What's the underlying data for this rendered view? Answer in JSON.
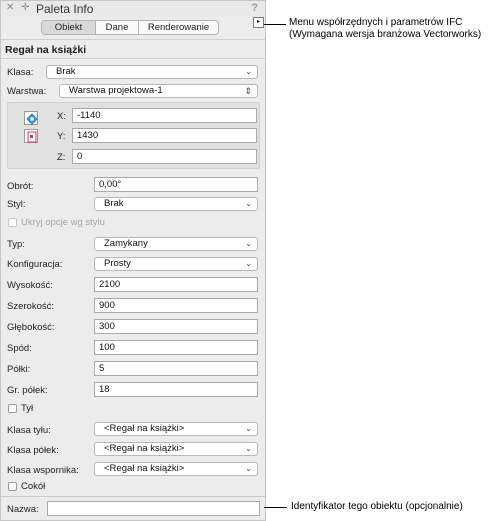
{
  "window": {
    "title": "Paleta Info",
    "help": "?"
  },
  "tabs": [
    {
      "label": "Obiekt",
      "active": true
    },
    {
      "label": "Dane",
      "active": false
    },
    {
      "label": "Renderowanie",
      "active": false
    }
  ],
  "ifc_button": "▸",
  "object_name": "Regał na książki",
  "klasa": {
    "label": "Klasa:",
    "value": "Brak"
  },
  "warstwa": {
    "label": "Warstwa:",
    "value": "Warstwa projektowa-1"
  },
  "coords": {
    "x_label": "X:",
    "x_value": "-1140",
    "y_label": "Y:",
    "y_value": "1430",
    "z_label": "Z:",
    "z_value": "0"
  },
  "obrot": {
    "label": "Obrót:",
    "value": "0,00°"
  },
  "styl": {
    "label": "Styl:",
    "value": "Brak"
  },
  "ukryj": {
    "label": "Ukryj opcje wg stylu",
    "checked": false
  },
  "typ": {
    "label": "Typ:",
    "value": "Zamykany"
  },
  "konfiguracja": {
    "label": "Konfiguracja:",
    "value": "Prosty"
  },
  "wysokosc": {
    "label": "Wysokość:",
    "value": "2100"
  },
  "szerokosc": {
    "label": "Szerokość:",
    "value": "900"
  },
  "glebokosc": {
    "label": "Głębokość:",
    "value": "300"
  },
  "spod": {
    "label": "Spód:",
    "value": "100"
  },
  "polki": {
    "label": "Półki:",
    "value": "5"
  },
  "gr_polek": {
    "label": "Gr. półek:",
    "value": "18"
  },
  "tyl": {
    "label": "Tył",
    "checked": false
  },
  "klasa_tylu": {
    "label": "Klasa tyłu:",
    "value": "<Regał na książki>"
  },
  "klasa_polek": {
    "label": "Klasa półek:",
    "value": "<Regał na książki>"
  },
  "klasa_wspornika": {
    "label": "Klasa wspornika:",
    "value": "<Regał na książki>"
  },
  "cokol": {
    "label": "Cokół",
    "checked": false
  },
  "nazwa": {
    "label": "Nazwa:",
    "value": ""
  },
  "callouts": {
    "ifc_line1": "Menu współrzędnych i parametrów IFC",
    "ifc_line2": "(Wymagana wersja branżowa Vectorworks)",
    "id_text": "Identyfikator tego obiektu (opcjonalnie)"
  },
  "colors": {
    "palette_bg": "#ececec",
    "field_bg": "#ffffff",
    "coord_box_bg": "#e1e1e1",
    "icon_blue": "#3aa0d8",
    "icon_pink": "#d6336c"
  },
  "icons": [
    "close-icon",
    "zoom-icon",
    "help-icon",
    "ifc-menu-icon",
    "chevron-down-icon",
    "updown-chevron-icon",
    "position-icon",
    "rotation-icon"
  ]
}
